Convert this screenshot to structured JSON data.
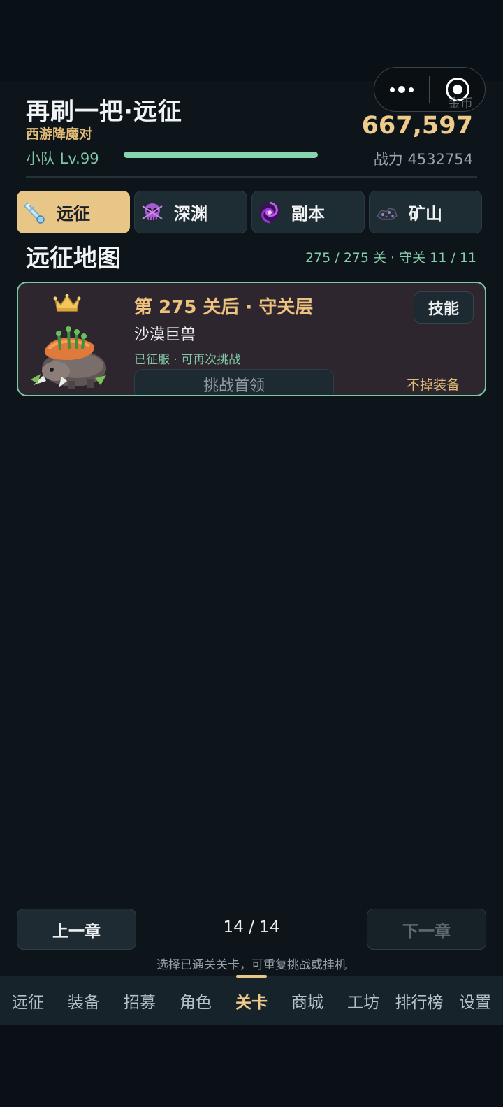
{
  "header": {
    "title": "再刷一把·远征",
    "subtitle": "西游降魔对",
    "team_level": "小队 Lv.99",
    "xp_progress": 1.0,
    "gold_label": "金币",
    "gold_value": "667,597",
    "power": "战力 4532754"
  },
  "mode_tabs": [
    {
      "label": "远征",
      "icon": "sword-gem-icon",
      "active": true
    },
    {
      "label": "深渊",
      "icon": "skull-icon",
      "active": false
    },
    {
      "label": "副本",
      "icon": "vortex-icon",
      "active": false
    },
    {
      "label": "矿山",
      "icon": "ore-icon",
      "active": false
    }
  ],
  "section": {
    "title": "远征地图",
    "meta": "275 / 275 关 · 守关 11 / 11"
  },
  "stage_card": {
    "title": "第 275 关后 · 守关层",
    "boss_name": "沙漠巨兽",
    "status": "已征服 · 可再次挑战",
    "skill_label": "技能",
    "challenge_label": "挑战首领",
    "drop_note": "不掉装备"
  },
  "chapter_nav": {
    "prev_label": "上一章",
    "next_label": "下一章",
    "count": "14 / 14",
    "hint": "选择已通关关卡，可重复挑战或挂机"
  },
  "bottom_nav": [
    {
      "label": "远征",
      "active": false
    },
    {
      "label": "装备",
      "active": false
    },
    {
      "label": "招募",
      "active": false
    },
    {
      "label": "角色",
      "active": false
    },
    {
      "label": "关卡",
      "active": true
    },
    {
      "label": "商城",
      "active": false
    },
    {
      "label": "工坊",
      "active": false
    },
    {
      "label": "排行榜",
      "active": false
    },
    {
      "label": "设置",
      "active": false
    }
  ],
  "colors": {
    "accent_gold": "#e8c688",
    "accent_green": "#7fc8a6",
    "background": "#0d151b"
  }
}
